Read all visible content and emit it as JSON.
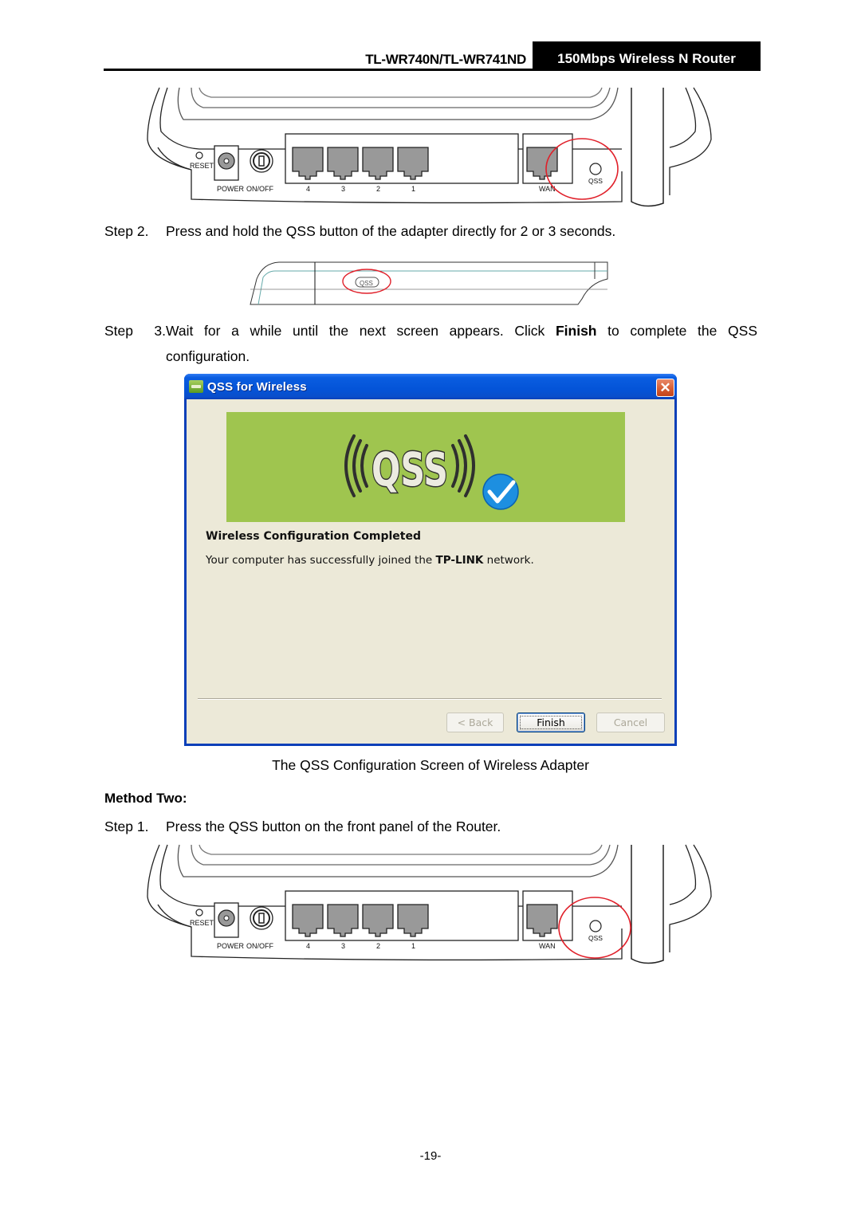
{
  "header": {
    "model": "TL-WR740N/TL-WR741ND",
    "product": "150Mbps Wireless N Router"
  },
  "router_panel": {
    "labels": {
      "reset": "RESET",
      "power": "POWER",
      "onoff": "ON/OFF",
      "lan_ports": [
        "4",
        "3",
        "2",
        "1"
      ],
      "wan": "WAN",
      "qss": "QSS"
    },
    "highlight_color": "#e0202a"
  },
  "steps_method_one": [
    {
      "label": "Step 2.",
      "text": "Press and hold the QSS button of the adapter directly for 2 or 3 seconds."
    },
    {
      "label": "Step 3.",
      "text_before": "Wait for a while until the next screen appears. Click ",
      "bold": "Finish",
      "text_after": " to complete the QSS",
      "continuation": "configuration."
    }
  ],
  "adapter": {
    "button_label": "QSS"
  },
  "dialog": {
    "title": "QSS for Wireless",
    "close_label": "✕",
    "banner_text": "QSS",
    "banner_color": "#9fc54f",
    "heading": "Wireless Configuration Completed",
    "message_before": "Your computer has successfully joined the ",
    "message_brand": "TP-LINK",
    "message_after": " network.",
    "buttons": {
      "back": "< Back",
      "finish": "Finish",
      "cancel": "Cancel"
    }
  },
  "caption": "The QSS Configuration Screen of Wireless Adapter",
  "method_two": {
    "title": "Method Two:",
    "steps": [
      {
        "label": "Step 1.",
        "text": "Press the QSS button on the front panel of the Router."
      }
    ]
  },
  "page_number": "-19-"
}
